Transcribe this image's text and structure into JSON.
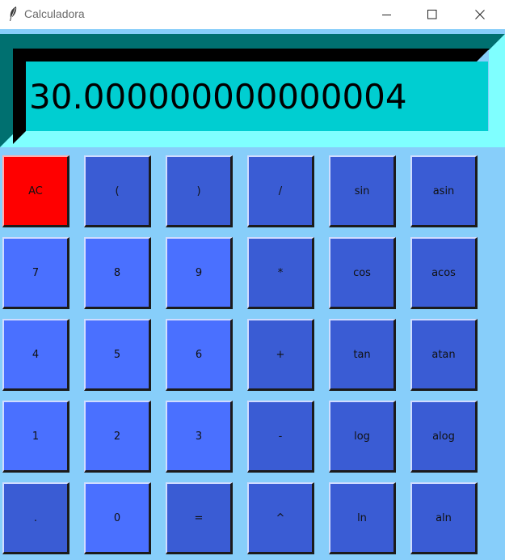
{
  "window": {
    "title": "Calculadora",
    "app_icon": "feather-icon",
    "controls": [
      "minimize-icon",
      "maximize-icon",
      "close-icon"
    ]
  },
  "display": {
    "value": "30.000000000000004"
  },
  "keypad": {
    "rows": [
      [
        "AC",
        "(",
        ")",
        "/",
        "sin",
        "asin"
      ],
      [
        "7",
        "8",
        "9",
        "*",
        "cos",
        "acos"
      ],
      [
        "4",
        "5",
        "6",
        "+",
        "tan",
        "atan"
      ],
      [
        "1",
        "2",
        "3",
        "-",
        "log",
        "alog"
      ],
      [
        ".",
        "0",
        "=",
        "^",
        "ln",
        "aln"
      ]
    ]
  },
  "colors": {
    "window_background": "#87cefa",
    "display_background": "#00ced1",
    "display_bevel_light": "#7fffff",
    "display_bevel_dark": "#007070",
    "digit_key": "#4a70ff",
    "operator_key": "#3a5cd4",
    "clear_key": "#ff0000"
  }
}
